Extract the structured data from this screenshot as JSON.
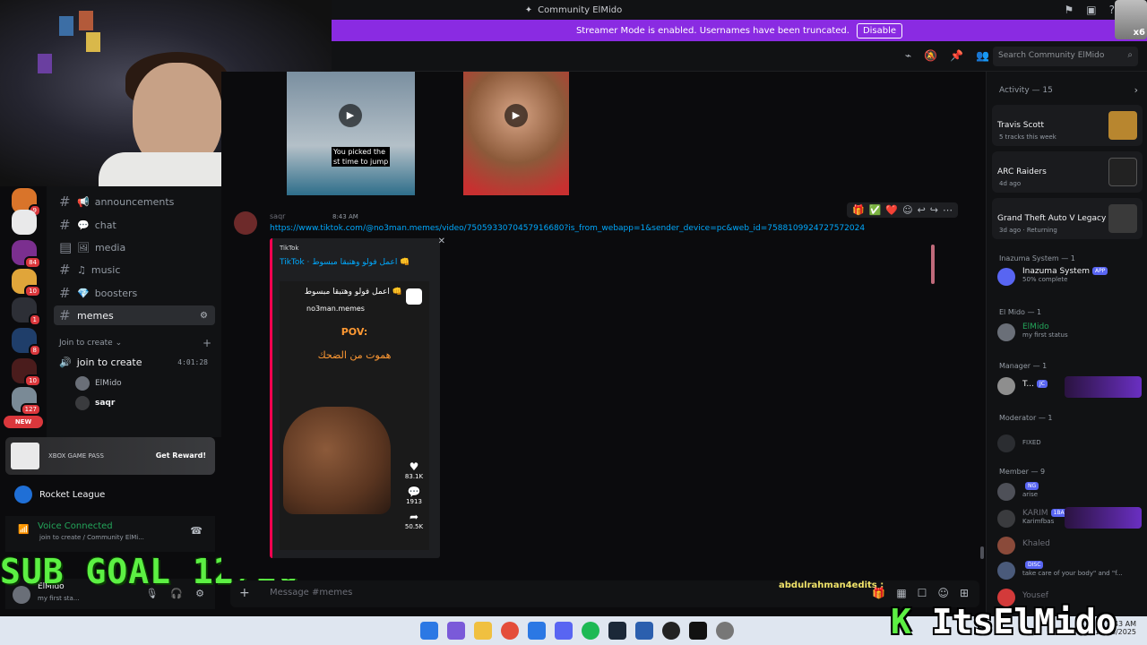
{
  "window": {
    "title": "Community ElMido"
  },
  "banner": {
    "text": "Streamer Mode is enabled. Usernames have been truncated.",
    "button": "Disable"
  },
  "search": {
    "placeholder": "Search Community ElMido"
  },
  "server_badges": [
    "9",
    "84",
    "10",
    "1",
    "8",
    "10",
    "127"
  ],
  "new_label": "NEW",
  "channels": [
    {
      "name": "announcements",
      "icon": "megaphone-icon"
    },
    {
      "name": "chat",
      "icon": "chat-bubble-icon"
    },
    {
      "name": "media",
      "icon": "image-icon"
    },
    {
      "name": "music",
      "icon": "music-icon"
    },
    {
      "name": "boosters",
      "icon": "diamond-icon"
    },
    {
      "name": "memes",
      "icon": "hash-icon"
    }
  ],
  "voice_category": "Join to create",
  "voice_channel": {
    "name": "join to create",
    "timer": "4:01:28"
  },
  "voice_members": [
    "ElMido",
    "saqr"
  ],
  "promo": {
    "brand": "XBOX GAME PASS",
    "cta": "Get Reward!"
  },
  "now_playing": "Rocket League",
  "voice_status": {
    "title": "Voice Connected",
    "sub": "join to create / Community ElMi..."
  },
  "user": {
    "name": "ElMido",
    "status": "my first sta..."
  },
  "overlay": {
    "subgoal": "SUB GOAL 12/20",
    "brand_k": "K",
    "brand_text": "ItsElMido"
  },
  "video_thumb_caption": [
    "You picked the",
    "st time to jump"
  ],
  "message": {
    "author": "saqr",
    "time": "8:43 AM",
    "link": "https://www.tiktok.com/@no3man.memes/video/7505933070457916680?is_from_webapp=1&sender_device=pc&web_id=7588109924727572024"
  },
  "reactions": [
    "🎁",
    "✅",
    "❤️"
  ],
  "embed": {
    "provider": "TikTok",
    "title": "TikTok · اعمل فولو وهتبقا مبسوط 👊",
    "caption": "اعمل فولو وهتبقا مبسوط 👊",
    "handle": "no3man.memes",
    "pov": "POV:",
    "arabic": "هموت من الضحك",
    "likes": "83.1K",
    "comments": "1913",
    "shares": "50.5K"
  },
  "composer": {
    "placeholder": "Message #memes",
    "typing": "abdulrahman4edits :"
  },
  "activity": {
    "title": "Activity — 15",
    "cards": [
      {
        "name": "Travis Scott",
        "sub": "5 tracks this week",
        "color": "#b8862f"
      },
      {
        "name": "ARC Raiders",
        "sub": "4d ago",
        "color": "#222"
      },
      {
        "name": "Grand Theft Auto V Legacy",
        "sub": "3d ago · Returning",
        "color": "#3a3a3a"
      }
    ]
  },
  "sections": {
    "inazuma": "Inazuma System — 1",
    "elmido": "El Mido — 1",
    "manager": "Manager — 1",
    "moderator": "Moderator — 1",
    "member": "Member — 9"
  },
  "members": {
    "inazuma": {
      "name": "Inazuma System",
      "tag": "APP",
      "status": "50% complete"
    },
    "elmido": {
      "name": "ElMido",
      "status": "my first status"
    },
    "manager": {
      "name": "T...",
      "tag": "JC"
    },
    "moderator": {
      "status": "FIXED"
    },
    "m1": {
      "status": "arise",
      "tag": "NG"
    },
    "m2": {
      "name": "KARIM",
      "status": "Karimfbas",
      "tag": "1BAS"
    },
    "m3": {
      "name": "Khaled"
    },
    "m4": {
      "status": "take care of your body\" and \"f...",
      "tag": "DISC"
    },
    "m5": {
      "name": "Yousef"
    }
  },
  "clock": {
    "time": "8:43 AM",
    "date": "12/26/2025"
  }
}
